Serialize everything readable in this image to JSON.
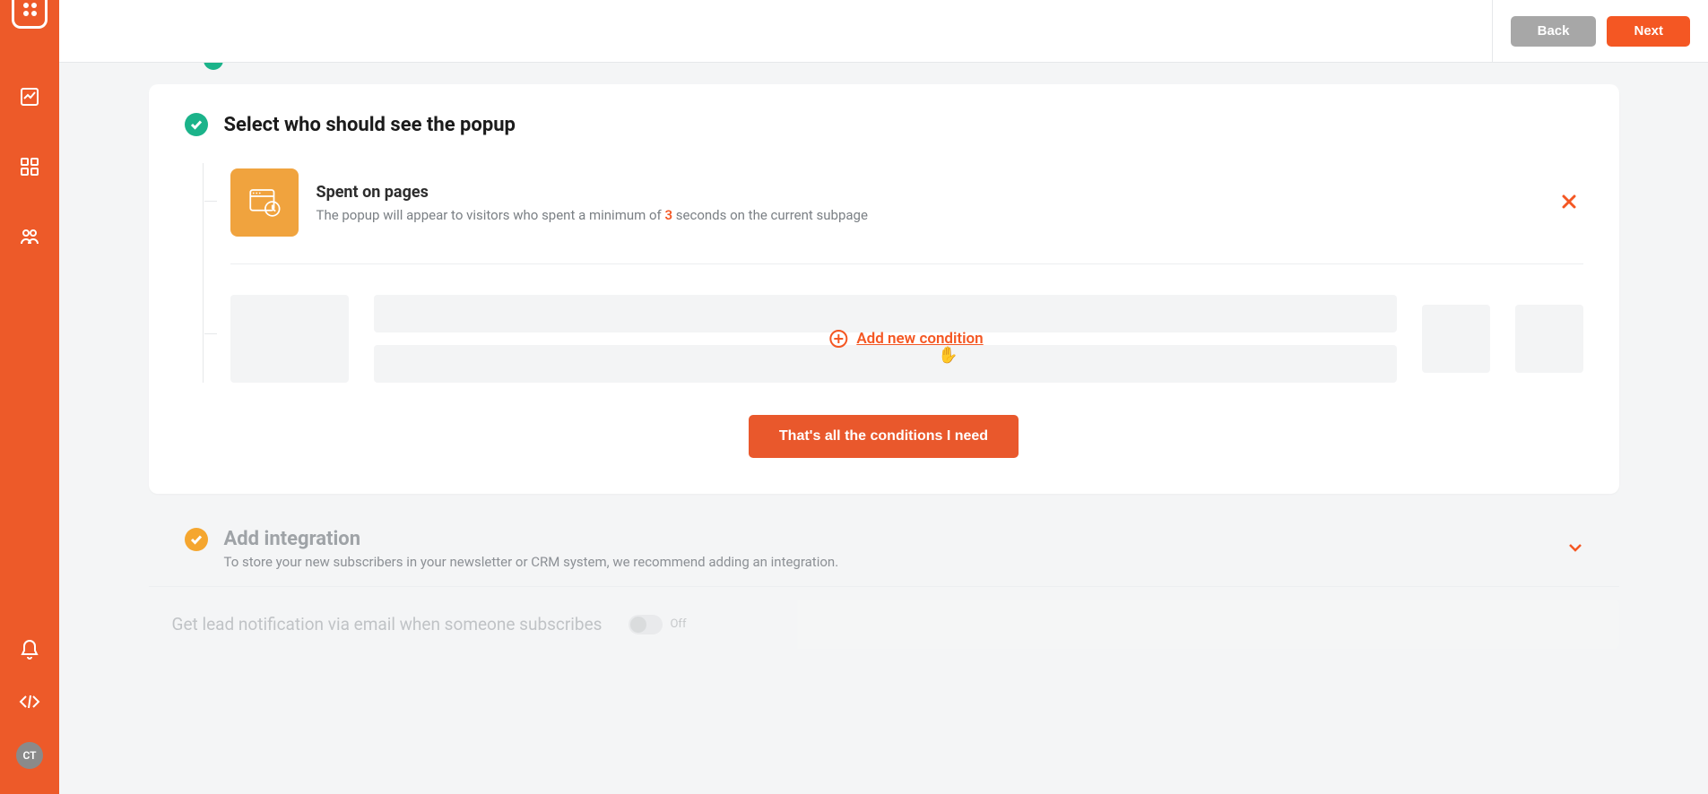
{
  "topbar": {
    "back_label": "Back",
    "next_label": "Next"
  },
  "sidebar": {
    "avatar_initials": "CT"
  },
  "section_select": {
    "title": "Select who should see the popup",
    "condition": {
      "title": "Spent on pages",
      "desc_before": "The popup will appear to visitors who spent a minimum of ",
      "seconds": "3",
      "desc_after": " seconds on the current subpage"
    },
    "add_condition_label": "Add new condition",
    "done_label": "That's all the conditions I need"
  },
  "section_integration": {
    "title": "Add integration",
    "desc": "To store your new subscribers in your newsletter or CRM system, we recommend adding an integration."
  },
  "lead_notification": {
    "label": "Get lead notification via email when someone subscribes",
    "toggle_state": "Off"
  }
}
